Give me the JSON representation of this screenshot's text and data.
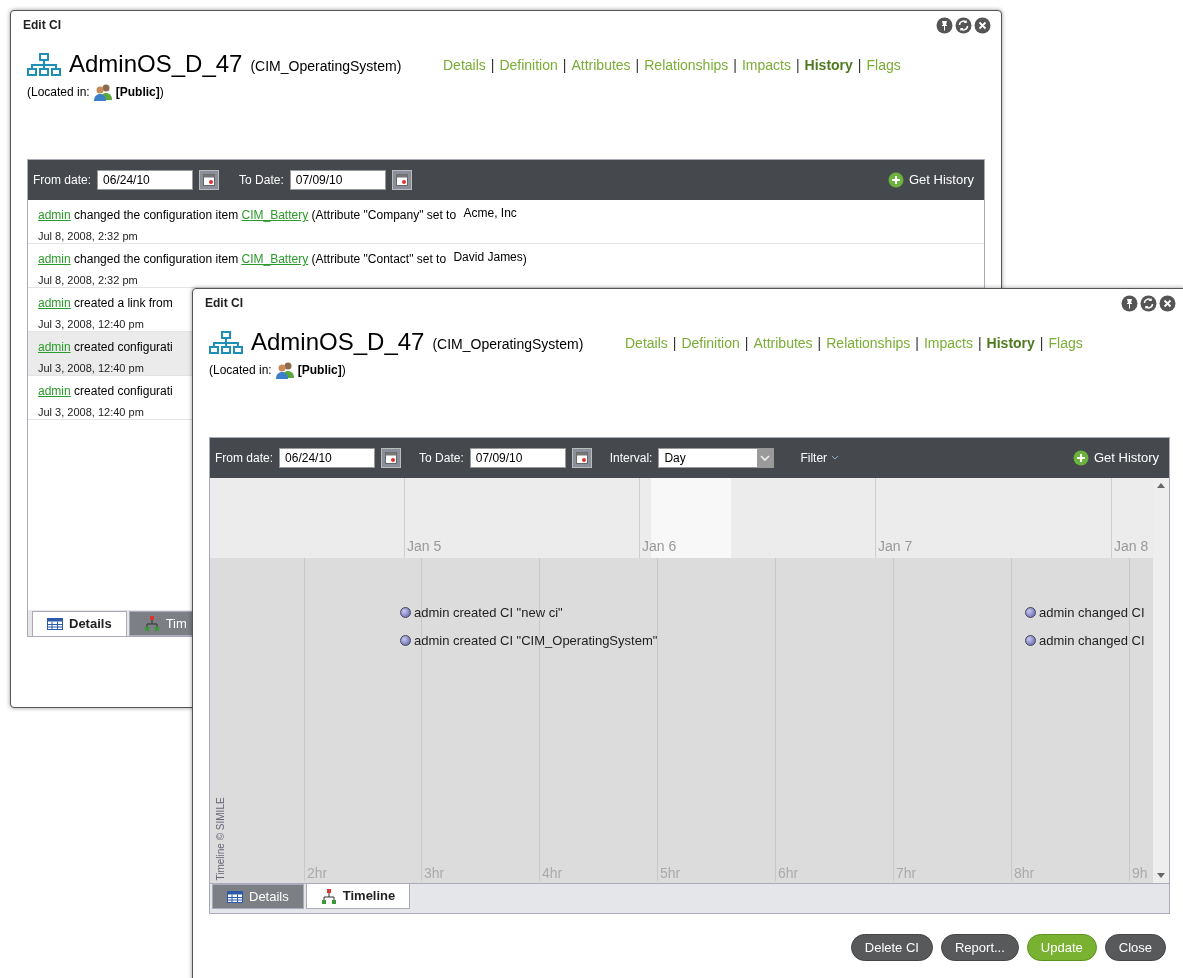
{
  "back_window": {
    "title": "Edit CI",
    "nav_separator": "|",
    "ci_name": "AdminOS_D_47",
    "ci_class": "(CIM_OperatingSystem)",
    "located_label": "(Located in:",
    "location": "[Public]",
    "located_close": ")",
    "nav": [
      {
        "label": "Details",
        "selected": false
      },
      {
        "label": "Definition",
        "selected": false
      },
      {
        "label": "Attributes",
        "selected": false
      },
      {
        "label": "Relationships",
        "selected": false
      },
      {
        "label": "Impacts",
        "selected": false
      },
      {
        "label": "History",
        "selected": true
      },
      {
        "label": "Flags",
        "selected": false
      }
    ],
    "toolbar": {
      "from_label": "From date:",
      "from_value": "06/24/10",
      "to_label": "To Date:",
      "to_value": "07/09/10",
      "get_history": "Get History"
    },
    "history": [
      {
        "user": "admin",
        "action": "changed the configuration item",
        "link": "CIM_Battery",
        "detail": "(Attribute \"Company\" set to",
        "value": "Acme, Inc",
        "time": "Jul 8, 2008, 2:32 pm",
        "selected": false
      },
      {
        "user": "admin",
        "action": "changed the configuration item",
        "link": "CIM_Battery",
        "detail": "(Attribute \"Contact\" set to",
        "value": "David James",
        "tail": ")",
        "time": "Jul 8, 2008, 2:32 pm",
        "selected": false
      },
      {
        "user": "admin",
        "action": "created a link from",
        "time": "Jul 3, 2008, 12:40 pm",
        "selected": false
      },
      {
        "user": "admin",
        "action": "created configurati",
        "time": "Jul 3, 2008, 12:40 pm",
        "selected": true
      },
      {
        "user": "admin",
        "action": "created configurati",
        "time": "Jul 3, 2008, 12:40 pm",
        "selected": false
      }
    ],
    "tabs": [
      {
        "label": "Details",
        "kind": "table",
        "selected": true
      },
      {
        "label": "Tim",
        "kind": "tree",
        "selected": false
      }
    ]
  },
  "front_window": {
    "title": "Edit CI",
    "nav_separator": "|",
    "ci_name": "AdminOS_D_47",
    "ci_class": "(CIM_OperatingSystem)",
    "located_label": "(Located in:",
    "location": "[Public]",
    "located_close": ")",
    "nav": [
      {
        "label": "Details",
        "selected": false
      },
      {
        "label": "Definition",
        "selected": false
      },
      {
        "label": "Attributes",
        "selected": false
      },
      {
        "label": "Relationships",
        "selected": false
      },
      {
        "label": "Impacts",
        "selected": false
      },
      {
        "label": "History",
        "selected": true
      },
      {
        "label": "Flags",
        "selected": false
      }
    ],
    "toolbar": {
      "from_label": "From date:",
      "from_value": "06/24/10",
      "to_label": "To Date:",
      "to_value": "07/09/10",
      "interval_label": "Interval:",
      "interval_value": "Day",
      "filter": "Filter",
      "get_history": "Get History"
    },
    "timeline": {
      "days": [
        "Jan 5",
        "Jan 6",
        "Jan 7",
        "Jan 8"
      ],
      "hours": [
        "2hr",
        "3hr",
        "4hr",
        "5hr",
        "6hr",
        "7hr",
        "8hr",
        "9h"
      ],
      "credit": "Timeline © SIMILE",
      "event_groups": [
        {
          "events": [
            "admin created CI \"new ci\"",
            "admin created CI \"CIM_OperatingSystem\""
          ]
        },
        {
          "events": [
            "admin changed CI",
            "admin changed CI"
          ]
        }
      ]
    },
    "tabs": [
      {
        "label": "Details",
        "kind": "table",
        "selected": false
      },
      {
        "label": "Timeline",
        "kind": "tree",
        "selected": true
      }
    ],
    "buttons": [
      {
        "label": "Delete CI",
        "kind": "normal"
      },
      {
        "label": "Report...",
        "kind": "normal"
      },
      {
        "label": "Update",
        "kind": "primary"
      },
      {
        "label": "Close",
        "kind": "normal"
      }
    ]
  }
}
